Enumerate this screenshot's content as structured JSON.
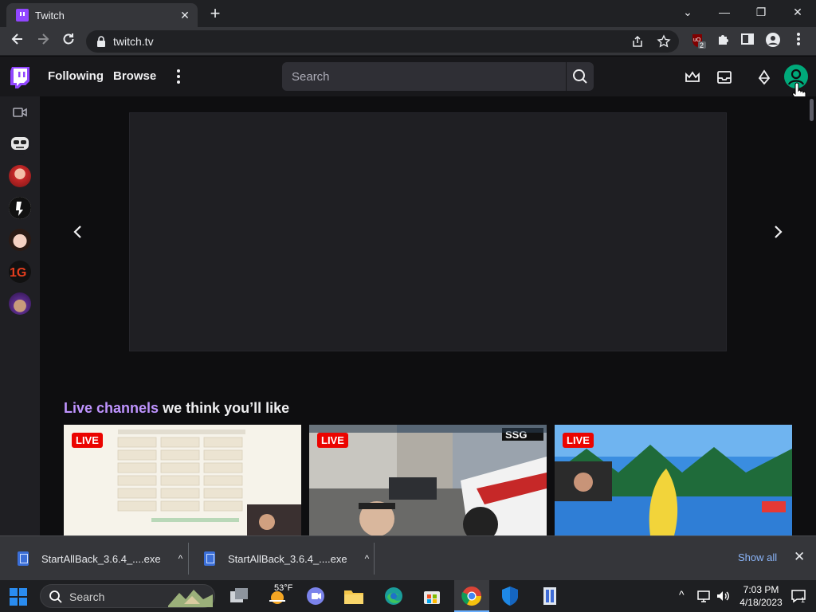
{
  "browser": {
    "tab_title": "Twitch",
    "tab_close": "✕",
    "new_tab": "+",
    "url": "twitch.tv",
    "ublock_badge": "2",
    "window_controls": {
      "minimize": "—",
      "restore": "❐",
      "close": "✕",
      "tab_search": "⌄"
    }
  },
  "twitch_nav": {
    "following_label": "Following",
    "browse_label": "Browse",
    "search_placeholder": "Search",
    "icons": [
      "prime-crown-icon",
      "inbox-icon",
      "bits-diamond-icon",
      "user-avatar-icon"
    ]
  },
  "sidebar": {
    "items": [
      {
        "name": "camera-icon"
      },
      {
        "name": "channel-avatar-1"
      },
      {
        "name": "channel-avatar-2"
      },
      {
        "name": "channel-avatar-3"
      },
      {
        "name": "channel-avatar-4"
      },
      {
        "name": "channel-avatar-5"
      },
      {
        "name": "channel-avatar-6"
      }
    ]
  },
  "main": {
    "section_title_highlight": "Live channels",
    "section_title_rest": " we think you’ll like",
    "cards": [
      {
        "live_label": "LIVE"
      },
      {
        "live_label": "LIVE"
      },
      {
        "live_label": "LIVE"
      }
    ]
  },
  "downloads": {
    "items": [
      {
        "filename": "StartAllBack_3.6.4_....exe",
        "chevron": "^"
      },
      {
        "filename": "StartAllBack_3.6.4_....exe",
        "chevron": "^"
      }
    ],
    "show_all_label": "Show all",
    "close": "✕"
  },
  "taskbar": {
    "search_label": "Search",
    "weather_temp": "53°F",
    "time": "7:03 PM",
    "date": "4/18/2023",
    "notification_count": "1"
  },
  "colors": {
    "twitch_purple": "#9146ff",
    "highlight_purple": "#bf94ff",
    "live_red": "#eb0400",
    "avatar_green": "#00a97a"
  }
}
